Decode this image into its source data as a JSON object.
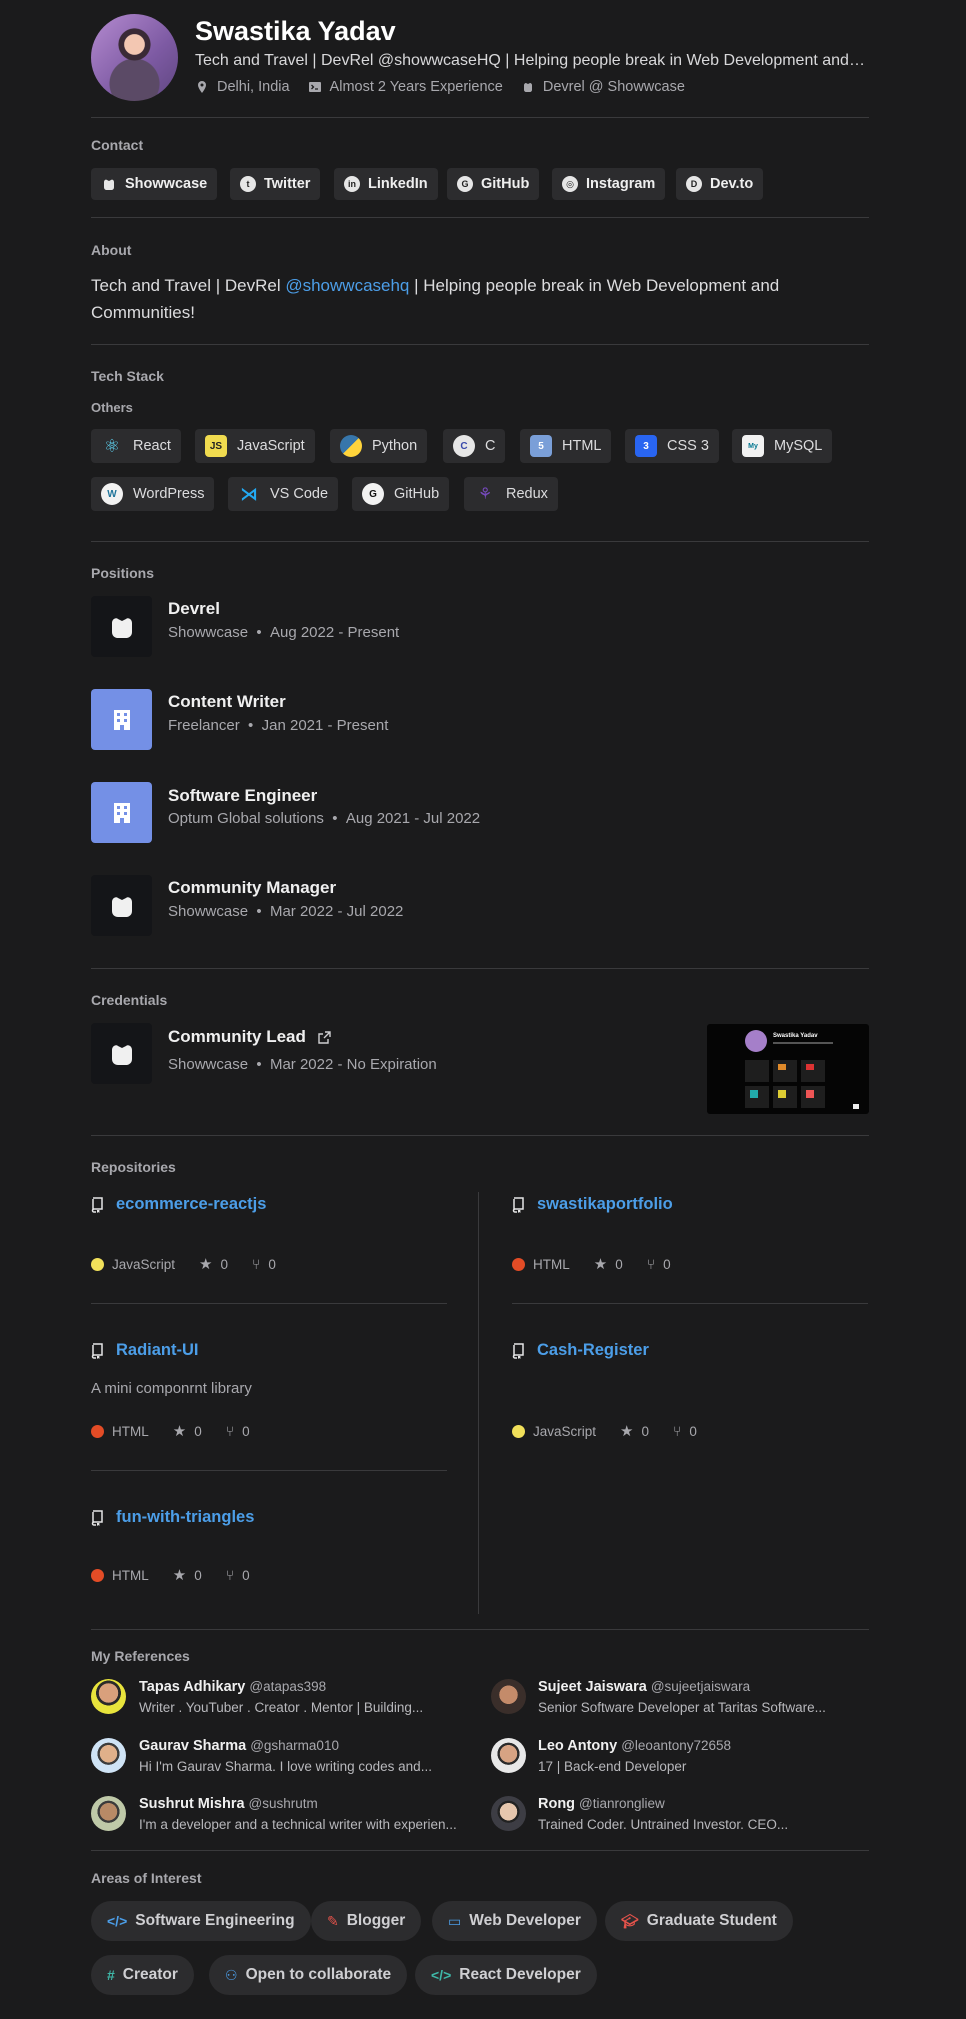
{
  "profile": {
    "name": "Swastika Yadav",
    "tagline": "Tech and Travel | DevRel @showwcaseHQ | Helping people break in Web Development and Communities!",
    "location": "Delhi, India",
    "experience": "Almost 2 Years Experience",
    "role": "Devrel @ Showwcase"
  },
  "contact": {
    "title": "Contact",
    "links": [
      "Showwcase",
      "Twitter",
      "LinkedIn",
      "GitHub",
      "Instagram",
      "Dev.to"
    ]
  },
  "about": {
    "title": "About",
    "text_before": "Tech and Travel | DevRel ",
    "link": "@showwcasehq",
    "text_after": " | Helping people break in Web Development and Communities!"
  },
  "tech_stack": {
    "title": "Tech Stack",
    "subtitle": "Others",
    "items": [
      "React",
      "JavaScript",
      "Python",
      "C",
      "HTML",
      "CSS 3",
      "MySQL",
      "WordPress",
      "VS Code",
      "GitHub",
      "Redux"
    ]
  },
  "positions": {
    "title": "Positions",
    "items": [
      {
        "title": "Devrel",
        "company": "Showwcase",
        "dates": "Aug 2022 - Present"
      },
      {
        "title": "Content Writer",
        "company": "Freelancer",
        "dates": "Jan 2021 - Present"
      },
      {
        "title": "Software Engineer",
        "company": "Optum Global solutions",
        "dates": "Aug 2021 - Jul 2022"
      },
      {
        "title": "Community Manager",
        "company": "Showwcase",
        "dates": "Mar 2022 - Jul 2022"
      }
    ]
  },
  "credentials": {
    "title": "Credentials",
    "item": {
      "title": "Community Lead",
      "company": "Showwcase",
      "dates": "Mar 2022 - No Expiration",
      "thumb_name": "Swastika Yadav"
    }
  },
  "repositories": {
    "title": "Repositories",
    "items": [
      {
        "name": "ecommerce-reactjs",
        "desc": "",
        "lang": "JavaScript",
        "stars": "0",
        "forks": "0",
        "color": "#f1e05a"
      },
      {
        "name": "swastikaportfolio",
        "desc": "",
        "lang": "HTML",
        "stars": "0",
        "forks": "0",
        "color": "#e34c26"
      },
      {
        "name": "Radiant-UI",
        "desc": "A mini componrnt library",
        "lang": "HTML",
        "stars": "0",
        "forks": "0",
        "color": "#e34c26"
      },
      {
        "name": "Cash-Register",
        "desc": "",
        "lang": "JavaScript",
        "stars": "0",
        "forks": "0",
        "color": "#f1e05a"
      },
      {
        "name": "fun-with-triangles",
        "desc": "",
        "lang": "HTML",
        "stars": "0",
        "forks": "0",
        "color": "#e34c26"
      }
    ]
  },
  "references": {
    "title": "My References",
    "items": [
      {
        "name": "Tapas Adhikary",
        "handle": "@atapas398",
        "bio": "Writer . YouTuber . Creator . Mentor | Building..."
      },
      {
        "name": "Sujeet Jaiswara",
        "handle": "@sujeetjaiswara",
        "bio": "Senior Software Developer at Taritas Software..."
      },
      {
        "name": "Gaurav Sharma",
        "handle": "@gsharma010",
        "bio": "Hi I'm Gaurav Sharma. I love writing codes and..."
      },
      {
        "name": "Leo Antony",
        "handle": "@leoantony72658",
        "bio": "17 | Back-end Developer"
      },
      {
        "name": "Sushrut Mishra",
        "handle": "@sushrutm",
        "bio": "I'm a developer and a technical writer with experien..."
      },
      {
        "name": "Rong",
        "handle": "@tianrongliew",
        "bio": "Trained Coder. Untrained Investor. CEO..."
      }
    ]
  },
  "interests": {
    "title": "Areas of Interest",
    "items": [
      "Software Engineering",
      "Blogger",
      "Web Developer",
      "Graduate Student",
      "Creator",
      "Open to collaborate",
      "React Developer"
    ]
  },
  "colors": {
    "link": "#4c9ee8",
    "bg": "#1b1b1c",
    "chip": "#2c2c2e"
  }
}
